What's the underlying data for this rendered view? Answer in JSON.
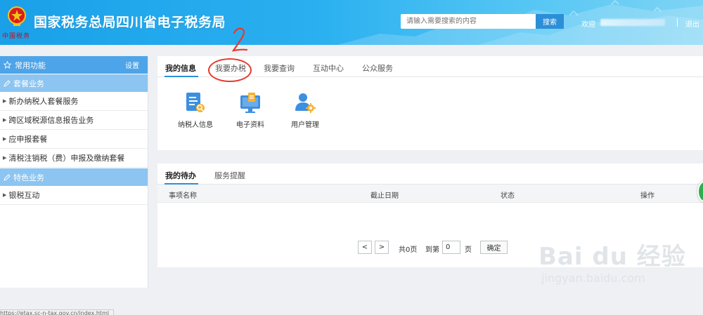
{
  "header": {
    "title": "国家税务总局四川省电子税务局",
    "emblem_text": "中国税务",
    "search": {
      "placeholder": "请输入需要搜索的内容",
      "button_label": "搜索"
    },
    "welcome": "欢迎",
    "logout_label": "退出",
    "colors": {
      "bar": "#1aa0e8",
      "search_button": "#2b8fd8"
    }
  },
  "sidebar": {
    "header": {
      "label": "常用功能",
      "settings_label": "设置"
    },
    "groups": [
      {
        "label": "套餐业务",
        "items": [
          "新办纳税人套餐服务",
          "跨区域税源信息报告业务",
          "应申报套餐",
          "清税注销税（费）申报及缴纳套餐"
        ]
      },
      {
        "label": "特色业务",
        "items": [
          "银税互动"
        ]
      }
    ]
  },
  "main": {
    "tabs": [
      "我的信息",
      "我要办税",
      "我要查询",
      "互动中心",
      "公众服务"
    ],
    "active_tab": "我的信息",
    "apps": [
      {
        "label": "纳税人信息",
        "icon": "taxpayer-info-icon"
      },
      {
        "label": "电子资料",
        "icon": "electronic-docs-icon"
      },
      {
        "label": "用户管理",
        "icon": "user-management-icon"
      }
    ],
    "todo": {
      "tabs": [
        "我的待办",
        "服务提醒"
      ],
      "columns": [
        "事项名称",
        "截止日期",
        "状态",
        "操作"
      ],
      "rows": [],
      "pager": {
        "prev": "<",
        "next": ">",
        "total": "共0页",
        "goto_label": "到第",
        "page_value": "0",
        "page_unit": "页",
        "confirm_label": "确定"
      }
    }
  },
  "annotation": {
    "number": "2",
    "color": "#e53a2d"
  },
  "watermark": {
    "main": "Bai du 经验",
    "sub": "jingyan.baidu.com"
  },
  "status_bar": {
    "url": "https://etax.sc-n-tax.gov.cn/index.html"
  }
}
